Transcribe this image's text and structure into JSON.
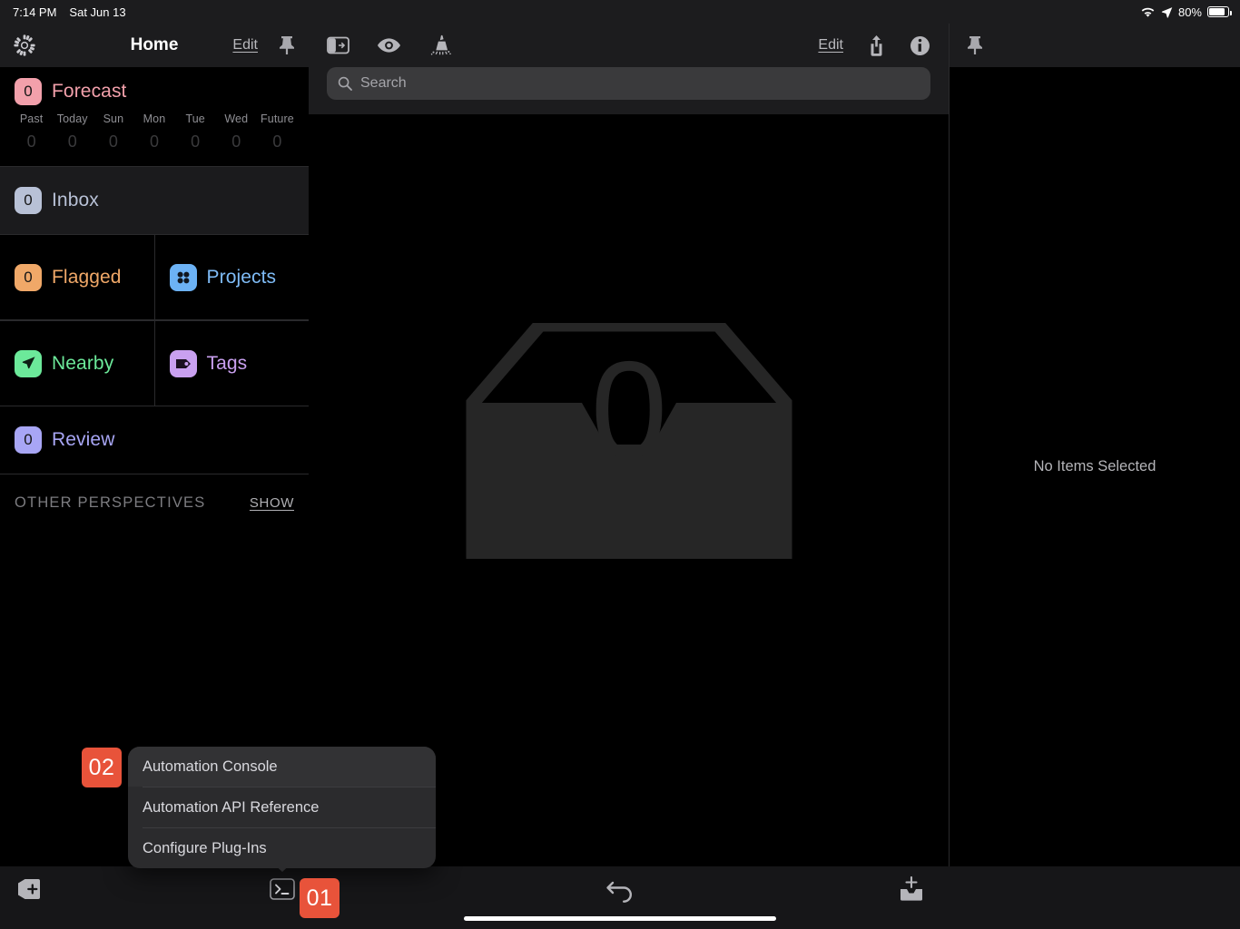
{
  "status_bar": {
    "time": "7:14 PM",
    "date": "Sat Jun 13",
    "battery_percent": "80%",
    "icons": [
      "wifi-icon",
      "location-arrow-icon",
      "battery-icon"
    ]
  },
  "sidebar": {
    "header": {
      "settings_icon": "gear-icon",
      "title": "Home",
      "edit_label": "Edit",
      "pin_icon": "pin-icon"
    },
    "forecast": {
      "count": "0",
      "label": "Forecast",
      "badge_color": "#f2a0ab",
      "text_color": "#f2a0ab",
      "days": [
        {
          "name": "Past",
          "count": "0"
        },
        {
          "name": "Today",
          "count": "0"
        },
        {
          "name": "Sun",
          "count": "0"
        },
        {
          "name": "Mon",
          "count": "0"
        },
        {
          "name": "Tue",
          "count": "0"
        },
        {
          "name": "Wed",
          "count": "0"
        },
        {
          "name": "Future",
          "count": "0"
        }
      ]
    },
    "inbox": {
      "count": "0",
      "label": "Inbox",
      "badge_color": "#b8c1d6",
      "text_color": "#b8c1d6"
    },
    "flagged": {
      "count": "0",
      "label": "Flagged",
      "badge_color": "#f0a868",
      "text_color": "#f0a868"
    },
    "projects": {
      "label": "Projects",
      "icon": "projects-dots-icon",
      "badge_color": "#6cb2f5",
      "text_color": "#7fbcf7"
    },
    "nearby": {
      "label": "Nearby",
      "icon": "location-arrow-icon",
      "badge_color": "#6ce99a",
      "text_color": "#6ce99a"
    },
    "tags": {
      "label": "Tags",
      "icon": "tag-icon",
      "badge_color": "#c9a0f0",
      "text_color": "#c9a0f0"
    },
    "review": {
      "count": "0",
      "label": "Review",
      "badge_color": "#a8a6f5",
      "text_color": "#a8a6f5"
    },
    "other_perspectives": {
      "title": "OTHER PERSPECTIVES",
      "show_label": "SHOW"
    }
  },
  "center": {
    "toolbar": {
      "sidebar_toggle_icon": "sidebar-toggle-icon",
      "view_icon": "eye-icon",
      "cleanup_icon": "broom-icon",
      "edit_label": "Edit",
      "share_icon": "share-icon",
      "info_icon": "info-icon"
    },
    "search": {
      "placeholder": "Search",
      "value": "",
      "icon": "search-icon"
    },
    "empty_state": {
      "icon": "empty-inbox-tray-icon",
      "count": "0"
    }
  },
  "inspector": {
    "pin_icon": "pin-icon",
    "empty_message": "No Items Selected"
  },
  "bottom_bar": {
    "add_project_icon": "add-project-icon",
    "automation_icon": "terminal-icon",
    "undo_icon": "undo-icon",
    "add_inbox_icon": "add-to-inbox-icon"
  },
  "popup_menu": {
    "items": [
      {
        "label": "Automation Console",
        "highlighted": true
      },
      {
        "label": "Automation API Reference",
        "highlighted": false
      },
      {
        "label": "Configure Plug-Ins",
        "highlighted": false
      }
    ]
  },
  "annotations": {
    "badge_01": "01",
    "badge_02": "02",
    "badge_color": "#e8533a"
  }
}
